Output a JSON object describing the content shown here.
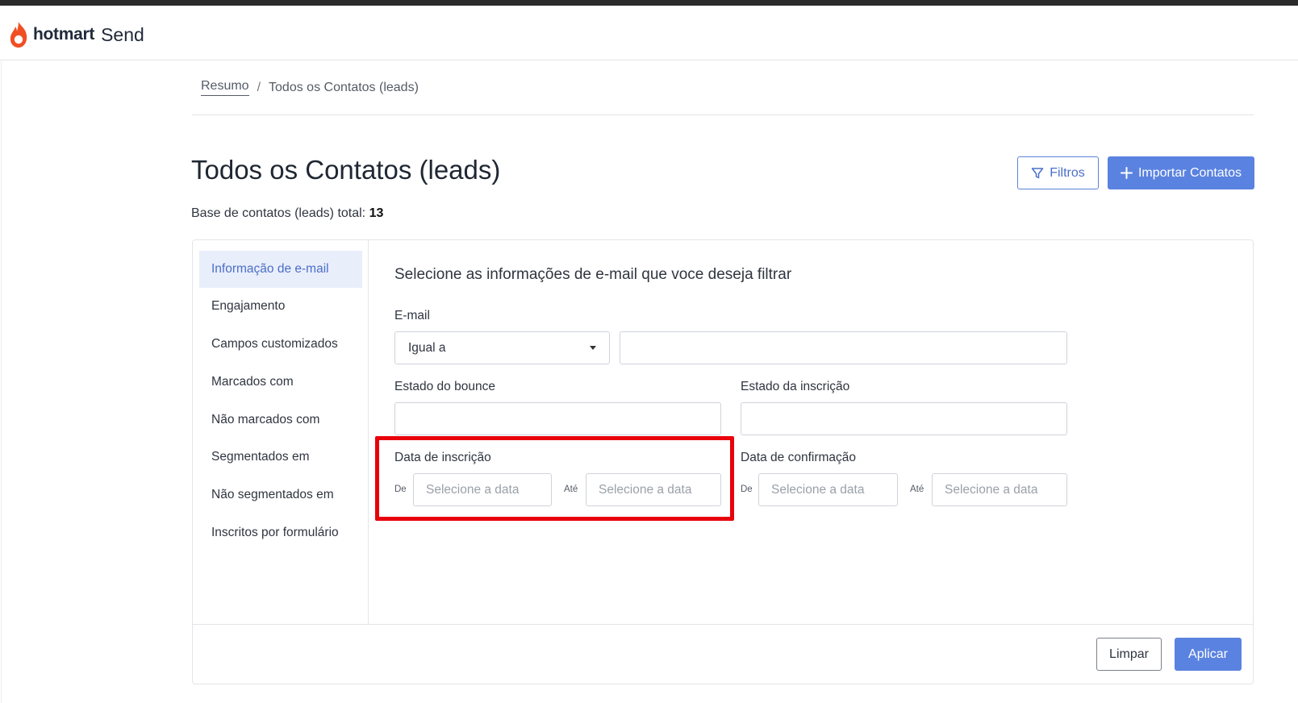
{
  "header": {
    "brand": "hotmart",
    "product": "Send"
  },
  "breadcrumb": {
    "home": "Resumo",
    "separator": "/",
    "current": "Todos os Contatos (leads)"
  },
  "page": {
    "title": "Todos os Contatos (leads)",
    "total_label": "Base de contatos (leads) total:",
    "total_value": "13"
  },
  "actions": {
    "filters_label": "Filtros",
    "import_label": "Importar Contatos"
  },
  "sidebar": {
    "items": [
      {
        "label": "Informação de e-mail",
        "active": true
      },
      {
        "label": "Engajamento",
        "active": false
      },
      {
        "label": "Campos customizados",
        "active": false
      },
      {
        "label": "Marcados com",
        "active": false
      },
      {
        "label": "Não marcados com",
        "active": false
      },
      {
        "label": "Segmentados em",
        "active": false
      },
      {
        "label": "Não segmentados em",
        "active": false
      },
      {
        "label": "Inscritos por formulário",
        "active": false
      }
    ]
  },
  "filters": {
    "title": "Selecione as informações de e-mail que voce deseja filtrar",
    "email": {
      "label": "E-mail",
      "operator": "Igual a",
      "value": ""
    },
    "bounce_state": {
      "label": "Estado do bounce",
      "value": ""
    },
    "subscription_state": {
      "label": "Estado da inscrição",
      "value": ""
    },
    "subscription_date": {
      "label": "Data de inscrição",
      "from_label": "De",
      "to_label": "Até",
      "from_placeholder": "Selecione a data",
      "to_placeholder": "Selecione a data"
    },
    "confirmation_date": {
      "label": "Data de confirmação",
      "from_label": "De",
      "to_label": "Até",
      "from_placeholder": "Selecione a data",
      "to_placeholder": "Selecione a data"
    }
  },
  "footer": {
    "clear_label": "Limpar",
    "apply_label": "Aplicar"
  },
  "colors": {
    "accent": "#5a82e0",
    "highlight": "#e8000b",
    "brand_flame": "#f04e23"
  },
  "icons": {
    "brand": "hotmart-flame-icon",
    "filter": "filter-icon",
    "add": "plus-icon",
    "dropdown": "caret-down-icon"
  }
}
